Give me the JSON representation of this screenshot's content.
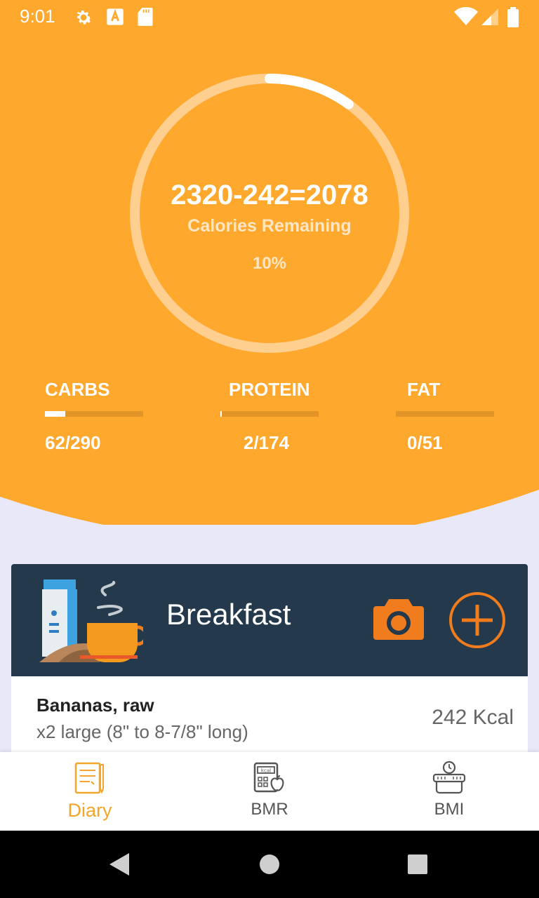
{
  "status_bar": {
    "time": "9:01"
  },
  "summary": {
    "equation": "2320-242=2078",
    "label": "Calories Remaining",
    "percent_text": "10%",
    "progress": 0.1
  },
  "macros": [
    {
      "name": "CARBS",
      "value": "62/290",
      "progress": 0.21
    },
    {
      "name": "PROTEIN",
      "value": "2/174",
      "progress": 0.01
    },
    {
      "name": "FAT",
      "value": "0/51",
      "progress": 0.0
    }
  ],
  "meal": {
    "title": "Breakfast",
    "items": [
      {
        "name": "Bananas, raw",
        "description": "x2 large (8\" to 8-7/8\" long)",
        "kcal": "242 Kcal"
      }
    ]
  },
  "bottom_nav": [
    {
      "label": "Diary",
      "icon": "diary-icon",
      "active": true
    },
    {
      "label": "BMR",
      "icon": "bmr-calculator-icon",
      "active": false
    },
    {
      "label": "BMI",
      "icon": "bmi-scale-icon",
      "active": false
    }
  ],
  "colors": {
    "accent": "#ffa82e",
    "meal_header": "#243a4c",
    "action_orange": "#f07c1d",
    "background": "#e8e8f8"
  }
}
